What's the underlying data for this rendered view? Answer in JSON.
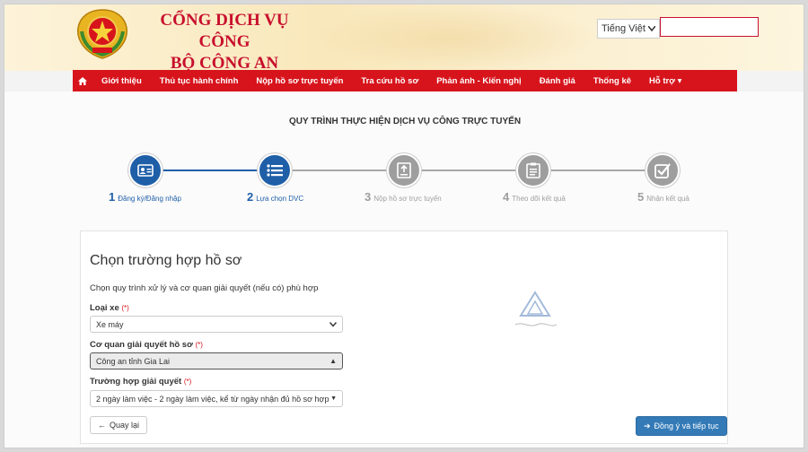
{
  "header": {
    "title_line1": "CỔNG DỊCH VỤ CÔNG",
    "title_line2": "BỘ CÔNG AN",
    "language": "Tiếng Việt",
    "search_value": ""
  },
  "nav": {
    "items": [
      "Giới thiệu",
      "Thủ tục hành chính",
      "Nộp hồ sơ trực tuyến",
      "Tra cứu hồ sơ",
      "Phản ánh - Kiến nghị",
      "Đánh giá",
      "Thống kê",
      "Hỗ trợ"
    ]
  },
  "process": {
    "title": "QUY TRÌNH THỰC HIỆN DỊCH VỤ CÔNG TRỰC TUYẾN",
    "steps": [
      {
        "num": "1",
        "label": "Đăng ký/Đăng nhập",
        "state": "done"
      },
      {
        "num": "2",
        "label": "Lựa chọn DVC",
        "state": "active"
      },
      {
        "num": "3",
        "label": "Nộp hồ sơ trực tuyến",
        "state": "pending"
      },
      {
        "num": "4",
        "label": "Theo dõi kết quả",
        "state": "pending"
      },
      {
        "num": "5",
        "label": "Nhận kết quả",
        "state": "pending"
      }
    ]
  },
  "form": {
    "title": "Chọn trường hợp hồ sơ",
    "description": "Chọn quy trình xử lý và cơ quan giải quyết (nếu có) phù hợp",
    "required_mark": "(*)",
    "vehicle_label": "Loại xe",
    "vehicle_value": "Xe máy",
    "agency_label": "Cơ quan giải quyết hồ sơ",
    "agency_value": "Công an tỉnh Gia Lai",
    "case_label": "Trường hợp giải quyết",
    "case_value": "2 ngày làm việc - 2 ngày làm việc, kể từ ngày nhận đủ hồ sơ hợp lệ",
    "back_label": "Quay lại",
    "next_label": "Đồng ý và tiếp tục"
  },
  "colors": {
    "brand_red": "#d7141c",
    "step_active": "#1f5fa8",
    "step_pending": "#9e9e9e",
    "button_primary": "#337ab7"
  }
}
